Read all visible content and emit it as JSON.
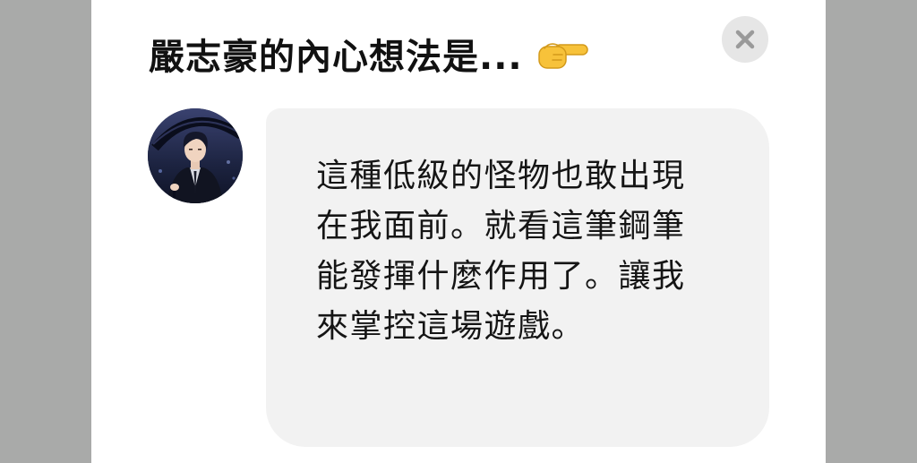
{
  "dialog": {
    "title": "嚴志豪的內心想法是...",
    "title_icon": "pointing-right-hand-icon",
    "close_icon": "close-icon",
    "avatar_icon": "character-avatar-icon",
    "message": "這種低級的怪物也敢出現在我面前。就看這筆鋼筆能發揮什麼作用了。讓我來掌控這場遊戲。"
  },
  "colors": {
    "backdrop": "#a9aaa9",
    "modal_background": "#ffffff",
    "bubble_background": "#f2f2f2",
    "close_button_background": "#e6e6e6",
    "close_icon": "#9a9a9a",
    "text": "#111111"
  }
}
